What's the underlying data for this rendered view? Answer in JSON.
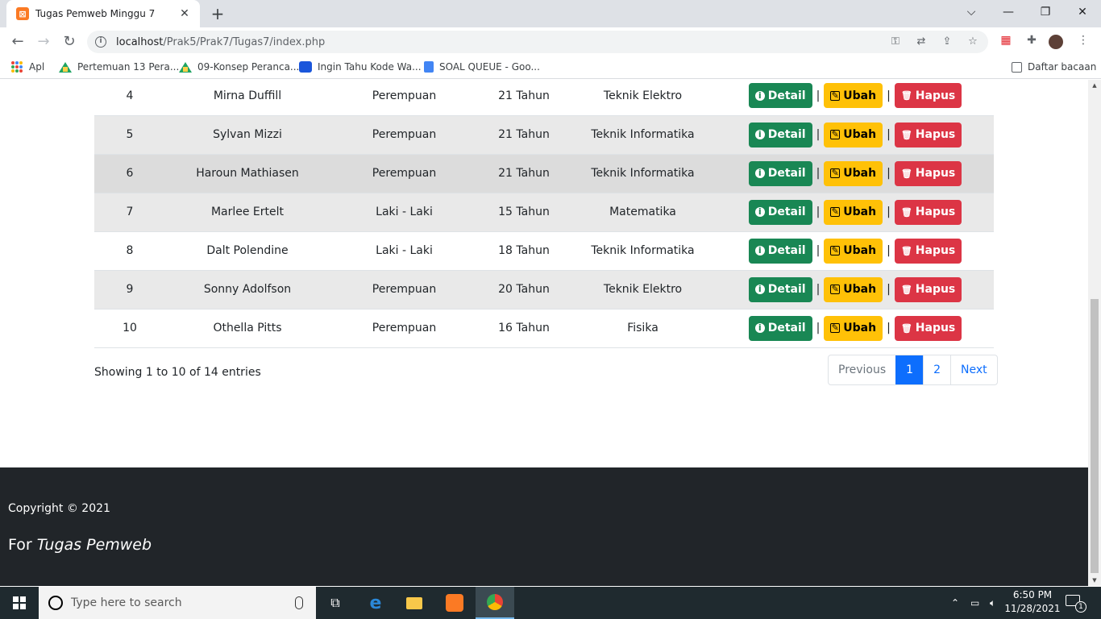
{
  "browser": {
    "tab_title": "Tugas Pemweb Minggu 7",
    "tab_close": "✕",
    "new_tab": "+",
    "win_controls": {
      "dropdown": "⌵",
      "minimize": "—",
      "restore": "❐",
      "close": "✕"
    },
    "url_host": "localhost",
    "url_path": "/Prak5/Prak7/Tugas7/index.php",
    "bookmarks": [
      {
        "label": "Apl"
      },
      {
        "label": "Pertemuan 13 Pera..."
      },
      {
        "label": "09-Konsep Peranca..."
      },
      {
        "label": "Ingin Tahu Kode Wa..."
      },
      {
        "label": "SOAL QUEUE - Goo..."
      }
    ],
    "reading_list": "Daftar bacaan"
  },
  "table": {
    "rows": [
      {
        "no": "4",
        "name": "Mirna Duffill",
        "gender": "Perempuan",
        "age": "21 Tahun",
        "major": "Teknik Elektro"
      },
      {
        "no": "5",
        "name": "Sylvan Mizzi",
        "gender": "Perempuan",
        "age": "21 Tahun",
        "major": "Teknik Informatika"
      },
      {
        "no": "6",
        "name": "Haroun Mathiasen",
        "gender": "Perempuan",
        "age": "21 Tahun",
        "major": "Teknik Informatika"
      },
      {
        "no": "7",
        "name": "Marlee Ertelt",
        "gender": "Laki - Laki",
        "age": "15 Tahun",
        "major": "Matematika"
      },
      {
        "no": "8",
        "name": "Dalt Polendine",
        "gender": "Laki - Laki",
        "age": "18 Tahun",
        "major": "Teknik Informatika"
      },
      {
        "no": "9",
        "name": "Sonny Adolfson",
        "gender": "Perempuan",
        "age": "20 Tahun",
        "major": "Teknik Elektro"
      },
      {
        "no": "10",
        "name": "Othella Pitts",
        "gender": "Perempuan",
        "age": "16 Tahun",
        "major": "Fisika"
      }
    ],
    "actions": {
      "detail": "Detail",
      "ubah": "Ubah",
      "hapus": "Hapus",
      "separator": "|"
    }
  },
  "pagination": {
    "info": "Showing 1 to 10 of 14 entries",
    "previous": "Previous",
    "page1": "1",
    "page2": "2",
    "next": "Next"
  },
  "footer": {
    "copyright": "Copyright © 2021",
    "for_label": "For",
    "for_emph": "Tugas Pemweb"
  },
  "taskbar": {
    "search_placeholder": "Type here to search",
    "time": "6:50 PM",
    "date": "11/28/2021",
    "notification_count": "1"
  },
  "colors": {
    "detail": "#198754",
    "ubah": "#ffc107",
    "hapus": "#dc3545",
    "pager_active": "#0d6efd",
    "footer_bg": "#212529"
  }
}
